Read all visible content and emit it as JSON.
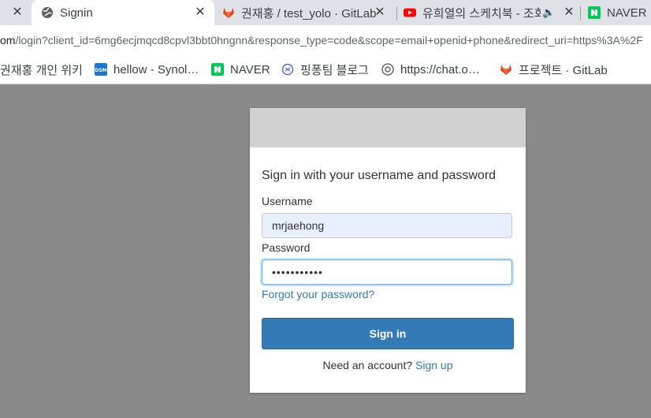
{
  "tabs": [
    {
      "label": "",
      "icon": "speaker-icon"
    },
    {
      "label": "Signin",
      "icon": "globe-icon",
      "active": true
    },
    {
      "label": "권재홍 / test_yolo · GitLab",
      "icon": "gitlab-icon"
    },
    {
      "label": "유희열의 스케치북 - 조회",
      "icon": "youtube-icon",
      "audio": true
    },
    {
      "label": "NAVER",
      "icon": "naver-icon"
    }
  ],
  "address_bar": {
    "url_host": "om",
    "url_rest": "/login?client_id=6mg6ecjmqcd8cpvl3bbt0hngnn&response_type=code&scope=email+openid+phone&redirect_uri=https%3A%2F"
  },
  "bookmarks": [
    {
      "label": "권재홍 개인 위키",
      "icon": "none"
    },
    {
      "label": "hellow - Synol…",
      "icon": "dsm-icon"
    },
    {
      "label": "NAVER",
      "icon": "naver-icon"
    },
    {
      "label": "핑퐁팀 블로그",
      "icon": "blog-icon"
    },
    {
      "label": "https://chat.o…",
      "icon": "openai-icon"
    },
    {
      "label": "프로젝트 · GitLab",
      "icon": "gitlab-icon"
    }
  ],
  "signin": {
    "title": "Sign in with your username and password",
    "username_label": "Username",
    "username_value": "mrjaehong",
    "password_label": "Password",
    "password_value": "•••••••••••",
    "forgot_link": "Forgot your password?",
    "submit_label": "Sign in",
    "need_account": "Need an account?",
    "signup_link": "Sign up"
  },
  "colors": {
    "primary": "#337ab7",
    "background": "#8a8a8a",
    "header": "#d1d1d1"
  }
}
